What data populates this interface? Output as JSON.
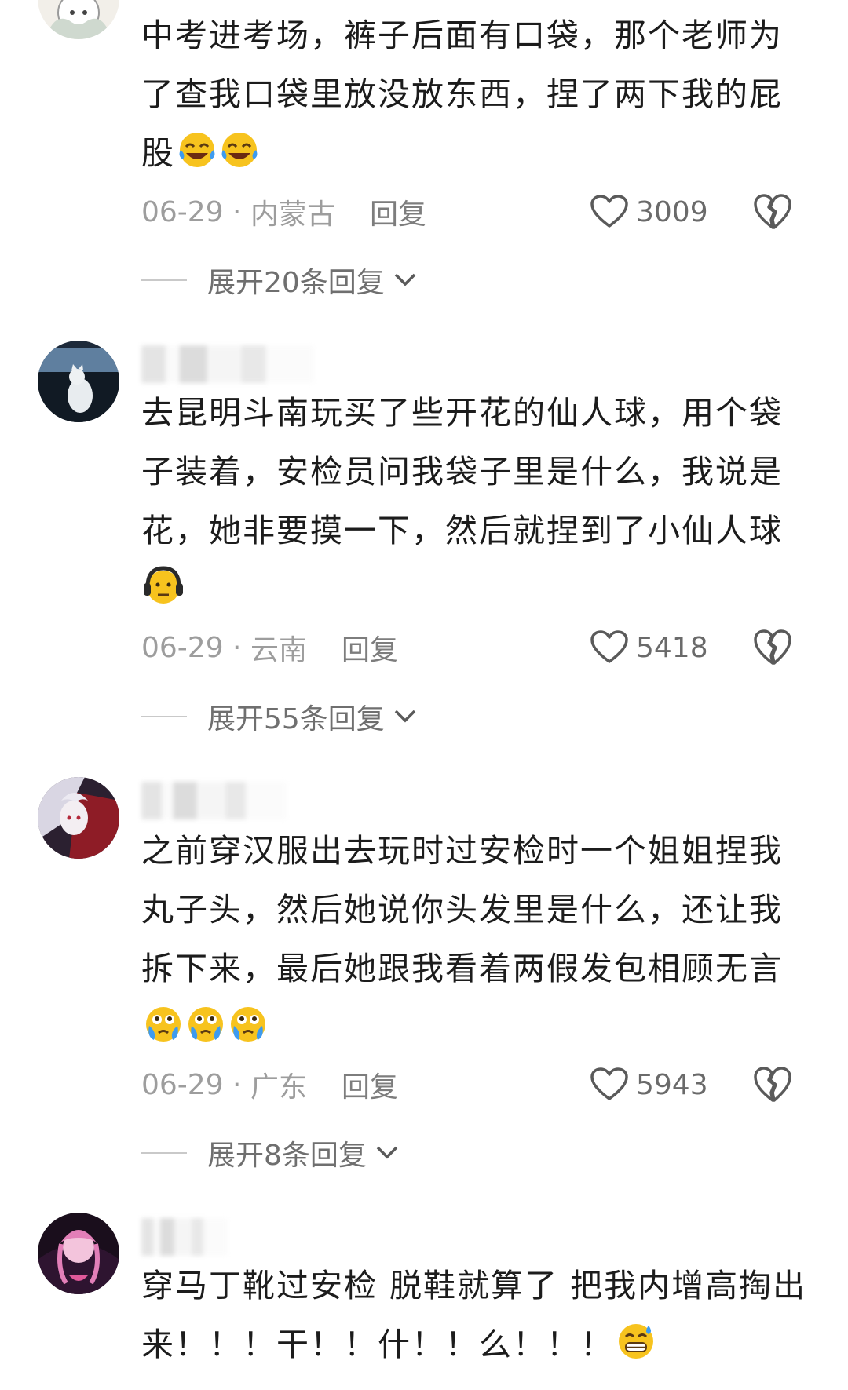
{
  "comments": [
    {
      "text": "中考进考场，裤子后面有口袋，那个老师为了查我口袋里放没放东西，捏了两下我的屁股",
      "emojis": [
        "rolling-laughing-emoji",
        "rolling-laughing-emoji"
      ],
      "date": "06-29",
      "location": "内蒙古",
      "reply_label": "回复",
      "likes": "3009",
      "expand_label": "展开20条回复"
    },
    {
      "text": "去昆明斗南玩买了些开花的仙人球，用个袋子装着，安检员问我袋子里是什么，我说是花，她非要摸一下，然后就捏到了小仙人球",
      "emojis": [
        "headphones-pained-emoji"
      ],
      "date": "06-29",
      "location": "云南",
      "reply_label": "回复",
      "likes": "5418",
      "expand_label": "展开55条回复"
    },
    {
      "text": "之前穿汉服出去玩时过安检时一个姐姐捏我丸子头，然后她说你头发里是什么，还让我拆下来，最后她跟我看着两假发包相顾无言",
      "emojis": [
        "teary-eyes-emoji",
        "teary-eyes-emoji",
        "teary-eyes-emoji"
      ],
      "date": "06-29",
      "location": "广东",
      "reply_label": "回复",
      "likes": "5943",
      "expand_label": "展开8条回复"
    },
    {
      "text": "穿马丁靴过安检 脱鞋就算了 把我内增高掏出来！！！干！！什！！么！！！",
      "emojis": [
        "grinning-sweat-emoji"
      ]
    }
  ],
  "colors": {
    "text": "#1c1c1c",
    "meta": "#9d9d9d",
    "emoji_yellow": "#f7c31e",
    "tear_blue": "#3d9bf0"
  }
}
